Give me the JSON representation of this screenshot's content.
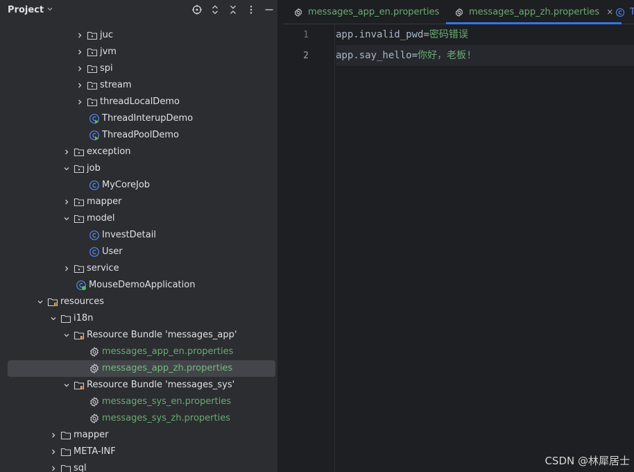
{
  "panel": {
    "title": "Project",
    "header_icons": [
      "locate-icon",
      "expand-collapse-icon",
      "collapse-all-icon",
      "more-vert-icon",
      "minimize-icon"
    ]
  },
  "tree": [
    {
      "label": "juc",
      "type": "package",
      "level": 4,
      "expanded": false
    },
    {
      "label": "jvm",
      "type": "package",
      "level": 4,
      "expanded": false
    },
    {
      "label": "spi",
      "type": "package",
      "level": 4,
      "expanded": false
    },
    {
      "label": "stream",
      "type": "package",
      "level": 4,
      "expanded": false
    },
    {
      "label": "threadLocalDemo",
      "type": "package",
      "level": 4,
      "expanded": false
    },
    {
      "label": "ThreadInterupDemo",
      "type": "class-run",
      "level": 4,
      "leaf": true
    },
    {
      "label": "ThreadPoolDemo",
      "type": "class-run",
      "level": 4,
      "leaf": true
    },
    {
      "label": "exception",
      "type": "package",
      "level": 3,
      "expanded": false
    },
    {
      "label": "job",
      "type": "package",
      "level": 3,
      "expanded": true
    },
    {
      "label": "MyCoreJob",
      "type": "class",
      "level": 4,
      "leaf": true
    },
    {
      "label": "mapper",
      "type": "package",
      "level": 3,
      "expanded": false
    },
    {
      "label": "model",
      "type": "package",
      "level": 3,
      "expanded": true
    },
    {
      "label": "InvestDetail",
      "type": "class",
      "level": 4,
      "leaf": true
    },
    {
      "label": "User",
      "type": "class",
      "level": 4,
      "leaf": true
    },
    {
      "label": "service",
      "type": "package",
      "level": 3,
      "expanded": false
    },
    {
      "label": "MouseDemoApplication",
      "type": "spring-app",
      "level": 3,
      "leaf": true
    },
    {
      "label": "resources",
      "type": "resources-folder",
      "level": 1,
      "expanded": true
    },
    {
      "label": "i18n",
      "type": "folder",
      "level": 2,
      "expanded": true
    },
    {
      "label": "Resource Bundle 'messages_app'",
      "type": "bundle",
      "level": 3,
      "expanded": true
    },
    {
      "label": "messages_app_en.properties",
      "type": "properties",
      "level": 4,
      "leaf": true,
      "green": true
    },
    {
      "label": "messages_app_zh.properties",
      "type": "properties",
      "level": 4,
      "leaf": true,
      "green": true,
      "selected": true
    },
    {
      "label": "Resource Bundle 'messages_sys'",
      "type": "bundle",
      "level": 3,
      "expanded": true
    },
    {
      "label": "messages_sys_en.properties",
      "type": "properties",
      "level": 4,
      "leaf": true,
      "green": true
    },
    {
      "label": "messages_sys_zh.properties",
      "type": "properties",
      "level": 4,
      "leaf": true,
      "green": true
    },
    {
      "label": "mapper",
      "type": "folder",
      "level": 2,
      "expanded": false
    },
    {
      "label": "META-INF",
      "type": "folder",
      "level": 2,
      "expanded": false
    },
    {
      "label": "sql",
      "type": "folder",
      "level": 2,
      "expanded": false
    }
  ],
  "tabs": [
    {
      "label": "messages_app_en.properties",
      "icon": "gear-icon",
      "active": false
    },
    {
      "label": "messages_app_zh.properties",
      "icon": "gear-icon",
      "active": true,
      "close": "×"
    },
    {
      "label": "T",
      "icon": "class-icon",
      "active": false
    }
  ],
  "editor": {
    "lines": [
      {
        "no": "1",
        "key": "app.invalid_pwd",
        "eq": "=",
        "value": "密码错误"
      },
      {
        "no": "2",
        "key": "app.say_hello",
        "eq": "=",
        "value": "你好，老板!",
        "current": true
      }
    ]
  },
  "watermark": "CSDN @林犀居士",
  "colors": {
    "accent": "#3574f0",
    "green_text": "#6aab73",
    "panel_bg": "#2b2d30",
    "editor_bg": "#1e1f22"
  }
}
